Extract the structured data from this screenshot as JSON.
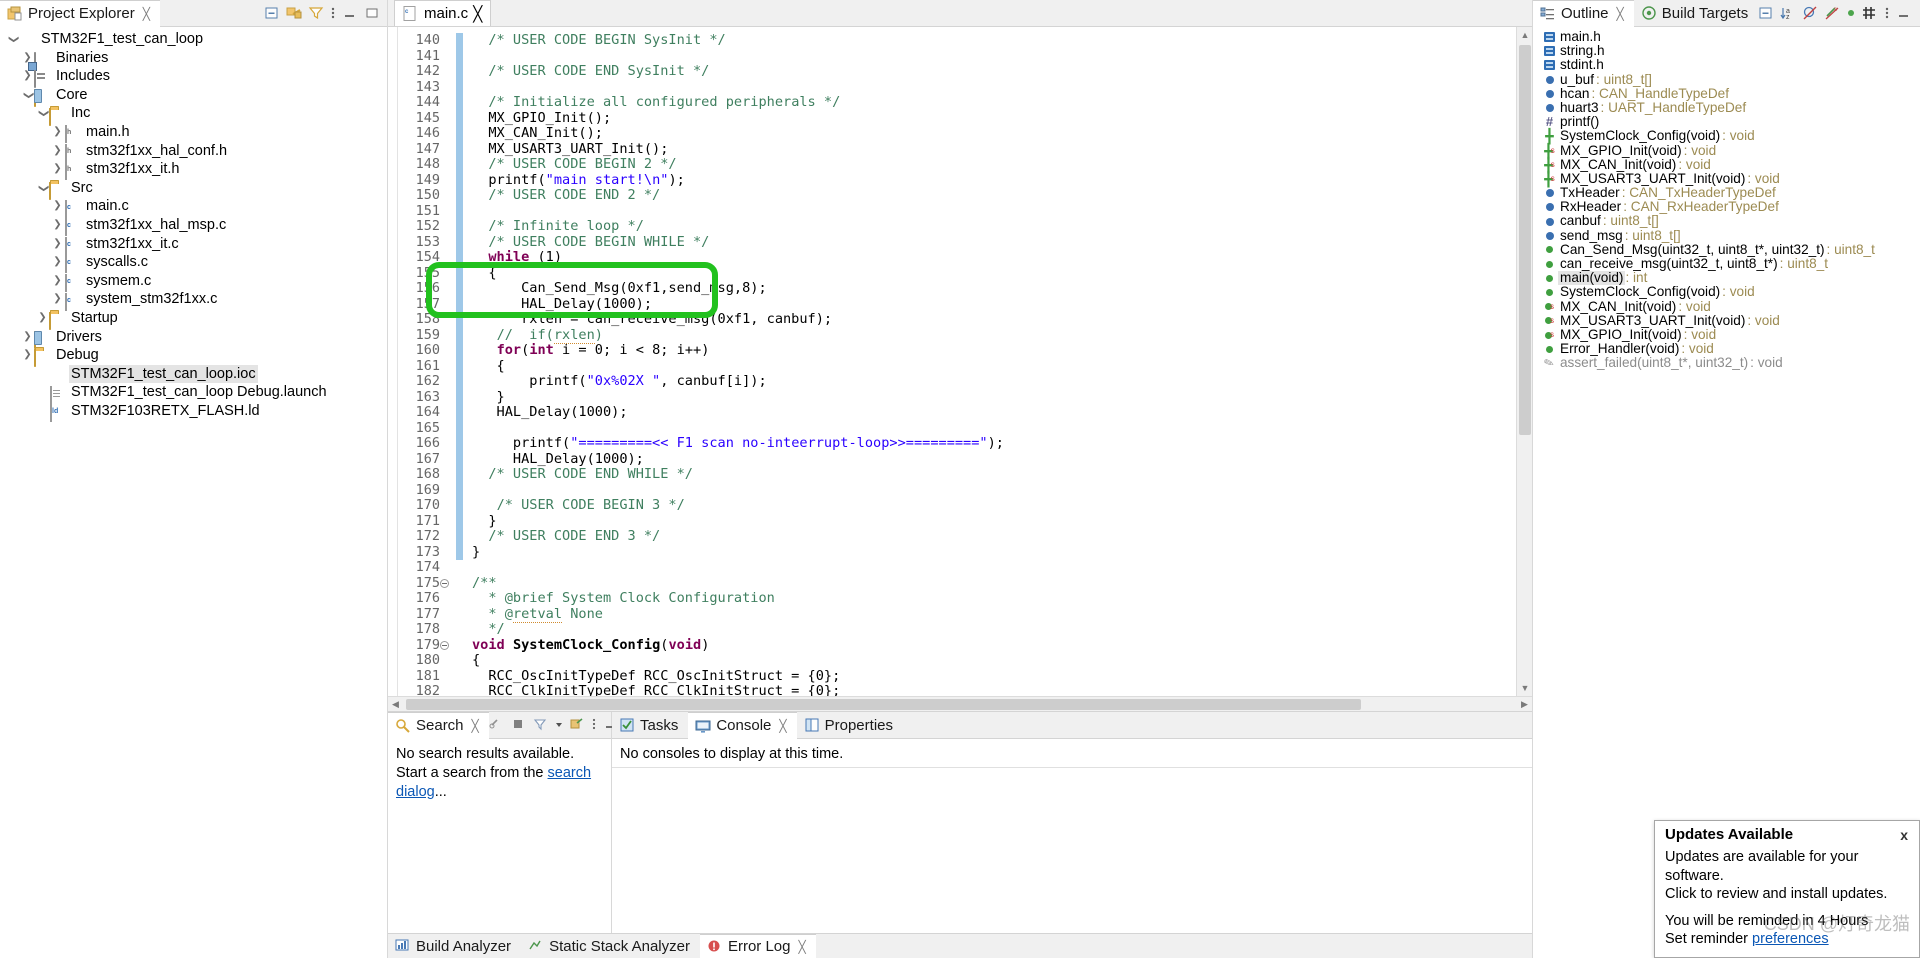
{
  "explorer": {
    "title": "Project Explorer",
    "toolbar_icons": [
      "collapse-all-icon",
      "link-with-editor-icon",
      "view-filter-icon",
      "view-menu-icon",
      "minimize-icon",
      "maximize-icon"
    ],
    "tree": [
      {
        "label": "STM32F1_test_can_loop",
        "indent": 0,
        "twisty": "v",
        "icon": "ide-project-icon",
        "selected": false
      },
      {
        "label": "Binaries",
        "indent": 1,
        "twisty": ">",
        "icon": "binaries-icon",
        "selected": false
      },
      {
        "label": "Includes",
        "indent": 1,
        "twisty": ">",
        "icon": "includes-icon",
        "selected": false
      },
      {
        "label": "Core",
        "indent": 1,
        "twisty": "v",
        "icon": "source-folder-icon",
        "selected": false
      },
      {
        "label": "Inc",
        "indent": 2,
        "twisty": "v",
        "icon": "folder-icon",
        "selected": false
      },
      {
        "label": "main.h",
        "indent": 3,
        "twisty": ">",
        "icon": "h-file-icon",
        "selected": false
      },
      {
        "label": "stm32f1xx_hal_conf.h",
        "indent": 3,
        "twisty": ">",
        "icon": "h-file-icon",
        "selected": false
      },
      {
        "label": "stm32f1xx_it.h",
        "indent": 3,
        "twisty": ">",
        "icon": "h-file-icon",
        "selected": false
      },
      {
        "label": "Src",
        "indent": 2,
        "twisty": "v",
        "icon": "folder-icon",
        "selected": false
      },
      {
        "label": "main.c",
        "indent": 3,
        "twisty": ">",
        "icon": "c-file-icon",
        "selected": false
      },
      {
        "label": "stm32f1xx_hal_msp.c",
        "indent": 3,
        "twisty": ">",
        "icon": "c-file-icon",
        "selected": false
      },
      {
        "label": "stm32f1xx_it.c",
        "indent": 3,
        "twisty": ">",
        "icon": "c-file-icon",
        "selected": false
      },
      {
        "label": "syscalls.c",
        "indent": 3,
        "twisty": ">",
        "icon": "c-file-icon",
        "selected": false
      },
      {
        "label": "sysmem.c",
        "indent": 3,
        "twisty": ">",
        "icon": "c-file-icon",
        "selected": false
      },
      {
        "label": "system_stm32f1xx.c",
        "indent": 3,
        "twisty": ">",
        "icon": "c-file-icon",
        "selected": false
      },
      {
        "label": "Startup",
        "indent": 2,
        "twisty": ">",
        "icon": "folder-icon",
        "selected": false
      },
      {
        "label": "Drivers",
        "indent": 1,
        "twisty": ">",
        "icon": "source-folder-icon",
        "selected": false
      },
      {
        "label": "Debug",
        "indent": 1,
        "twisty": ">",
        "icon": "folder-icon",
        "selected": false
      },
      {
        "label": "STM32F1_test_can_loop.ioc",
        "indent": 2,
        "twisty": "",
        "icon": "cubemx-icon",
        "selected": true
      },
      {
        "label": "STM32F1_test_can_loop Debug.launch",
        "indent": 2,
        "twisty": "",
        "icon": "launch-file-icon",
        "selected": false
      },
      {
        "label": "STM32F103RETX_FLASH.ld",
        "indent": 2,
        "twisty": "",
        "icon": "ld-file-icon",
        "selected": false
      }
    ]
  },
  "editor": {
    "tab_label": "main.c",
    "tab_icon": "c-file-icon",
    "first_line": 140,
    "lines": [
      {
        "n": 140,
        "html": "  <span class=\"cm\">/* USER CODE BEGIN SysInit */</span>"
      },
      {
        "n": 141,
        "html": ""
      },
      {
        "n": 142,
        "html": "  <span class=\"cm\">/* USER CODE END SysInit */</span>"
      },
      {
        "n": 143,
        "html": ""
      },
      {
        "n": 144,
        "html": "  <span class=\"cm\">/* Initialize all configured peripherals */</span>"
      },
      {
        "n": 145,
        "html": "  MX_GPIO_Init();"
      },
      {
        "n": 146,
        "html": "  MX_CAN_Init();"
      },
      {
        "n": 147,
        "html": "  MX_USART3_UART_Init();"
      },
      {
        "n": 148,
        "html": "  <span class=\"cm\">/* USER CODE BEGIN 2 */</span>"
      },
      {
        "n": 149,
        "html": "  printf(<span class=\"str\">\"main start!\\n\"</span>);"
      },
      {
        "n": 150,
        "html": "  <span class=\"cm\">/* USER CODE END 2 */</span>"
      },
      {
        "n": 151,
        "html": ""
      },
      {
        "n": 152,
        "html": "  <span class=\"cm\">/* Infinite loop */</span>"
      },
      {
        "n": 153,
        "html": "  <span class=\"cm\">/* USER CODE BEGIN WHILE */</span>"
      },
      {
        "n": 154,
        "html": "  <span class=\"kw\">while</span> (1)"
      },
      {
        "n": 155,
        "html": "  {"
      },
      {
        "n": 156,
        "html": "      Can_Send_Msg(0xf1,send_msg,8);"
      },
      {
        "n": 157,
        "html": "      HAL_Delay(1000);"
      },
      {
        "n": 158,
        "html": "      rxlen = can_receive_msg(0xf1, canbuf);"
      },
      {
        "n": 159,
        "html": "   <span class=\"cm\">//  if(<span class=\"squiggle\">rxlen</span>)</span>"
      },
      {
        "n": 160,
        "html": "   <span class=\"kw\">for</span>(<span class=\"kw\">int</span> i = 0; i &lt; 8; i++)"
      },
      {
        "n": 161,
        "html": "   {"
      },
      {
        "n": 162,
        "html": "       printf(<span class=\"str\">\"0x%02X \"</span>, canbuf[i]);"
      },
      {
        "n": 163,
        "html": "   }"
      },
      {
        "n": 164,
        "html": "   HAL_Delay(1000);"
      },
      {
        "n": 165,
        "html": ""
      },
      {
        "n": 166,
        "html": "     printf(<span class=\"str\">\"=========&lt;&lt; F1 scan no-inteerrupt-loop&gt;&gt;=========\"</span>);"
      },
      {
        "n": 167,
        "html": "     HAL_Delay(1000);"
      },
      {
        "n": 168,
        "html": "  <span class=\"cm\">/* USER CODE END WHILE */</span>"
      },
      {
        "n": 169,
        "html": ""
      },
      {
        "n": 170,
        "html": "   <span class=\"cm\">/* USER CODE BEGIN 3 */</span>"
      },
      {
        "n": 171,
        "html": "  }"
      },
      {
        "n": 172,
        "html": "  <span class=\"cm\">/* USER CODE END 3 */</span>"
      },
      {
        "n": 173,
        "html": "}"
      },
      {
        "n": 174,
        "html": ""
      },
      {
        "n": 175,
        "html": "<span class=\"cm\">/**</span>",
        "fold": true
      },
      {
        "n": 176,
        "html": "  <span class=\"cm\">* @brief System Clock Configuration</span>"
      },
      {
        "n": 177,
        "html": "  <span class=\"cm\">* @<span class=\"squiggle\">retval</span> None</span>"
      },
      {
        "n": 178,
        "html": "  <span class=\"cm\">*/</span>"
      },
      {
        "n": 179,
        "html": "<span class=\"kw\">void</span> <span class=\"fn\">SystemClock_Config</span>(<span class=\"kw\">void</span>)",
        "fold": true
      },
      {
        "n": 180,
        "html": "{"
      },
      {
        "n": 181,
        "html": "  RCC_OscInitTypeDef RCC_OscInitStruct = {0};"
      },
      {
        "n": 182,
        "html": "  RCC_ClkInitTypeDef RCC_ClkInitStruct = {0};"
      }
    ],
    "annotation": {
      "name": "green-highlight-box",
      "color": "#22c11e",
      "covers_lines": [
        155,
        156,
        157
      ]
    }
  },
  "outline": {
    "tabs": [
      {
        "label": "Outline",
        "icon": "outline-icon",
        "active": true
      },
      {
        "label": "Build Targets",
        "icon": "build-targets-icon",
        "active": false
      }
    ],
    "toolbar_icons": [
      "collapse-all-icon",
      "sort-icon",
      "hide-fields-icon",
      "hide-static-icon",
      "hide-nonpublic-icon",
      "focus-icon",
      "view-menu-icon",
      "minimize-icon",
      "maximize-icon"
    ],
    "items": [
      {
        "name": "main.h",
        "type": "",
        "icon": "include-icon",
        "selected": false,
        "static": false,
        "dim": false
      },
      {
        "name": "string.h",
        "type": "",
        "icon": "include-icon",
        "selected": false,
        "static": false,
        "dim": false
      },
      {
        "name": "stdint.h",
        "type": "",
        "icon": "include-icon",
        "selected": false,
        "static": false,
        "dim": false
      },
      {
        "name": "u_buf",
        "type": " : uint8_t[]",
        "icon": "variable-icon",
        "selected": false,
        "static": false,
        "dim": false
      },
      {
        "name": "hcan",
        "type": " : CAN_HandleTypeDef",
        "icon": "variable-icon",
        "selected": false,
        "static": false,
        "dim": false
      },
      {
        "name": "huart3",
        "type": " : UART_HandleTypeDef",
        "icon": "variable-icon",
        "selected": false,
        "static": false,
        "dim": false
      },
      {
        "name": "printf()",
        "type": "",
        "icon": "macro-icon",
        "selected": false,
        "static": false,
        "dim": false
      },
      {
        "name": "SystemClock_Config(void)",
        "type": " : void",
        "icon": "prototype-icon",
        "selected": false,
        "static": false,
        "dim": false
      },
      {
        "name": "MX_GPIO_Init(void)",
        "type": " : void",
        "icon": "prototype-icon",
        "selected": false,
        "static": true,
        "dim": false
      },
      {
        "name": "MX_CAN_Init(void)",
        "type": " : void",
        "icon": "prototype-icon",
        "selected": false,
        "static": true,
        "dim": false
      },
      {
        "name": "MX_USART3_UART_Init(void)",
        "type": " : void",
        "icon": "prototype-icon",
        "selected": false,
        "static": true,
        "dim": false
      },
      {
        "name": "TxHeader",
        "type": " : CAN_TxHeaderTypeDef",
        "icon": "variable-icon",
        "selected": false,
        "static": false,
        "dim": false
      },
      {
        "name": "RxHeader",
        "type": " : CAN_RxHeaderTypeDef",
        "icon": "variable-icon",
        "selected": false,
        "static": false,
        "dim": false
      },
      {
        "name": "canbuf",
        "type": " : uint8_t[]",
        "icon": "variable-icon",
        "selected": false,
        "static": false,
        "dim": false
      },
      {
        "name": "send_msg",
        "type": " : uint8_t[]",
        "icon": "variable-icon",
        "selected": false,
        "static": false,
        "dim": false
      },
      {
        "name": "Can_Send_Msg(uint32_t, uint8_t*, uint32_t)",
        "type": " : uint8_t",
        "icon": "function-icon",
        "selected": false,
        "static": false,
        "dim": false
      },
      {
        "name": "can_receive_msg(uint32_t, uint8_t*)",
        "type": " : uint8_t",
        "icon": "function-icon",
        "selected": false,
        "static": false,
        "dim": false
      },
      {
        "name": "main(void)",
        "type": " : int",
        "icon": "function-icon",
        "selected": true,
        "static": false,
        "dim": false
      },
      {
        "name": "SystemClock_Config(void)",
        "type": " : void",
        "icon": "function-icon",
        "selected": false,
        "static": false,
        "dim": false
      },
      {
        "name": "MX_CAN_Init(void)",
        "type": " : void",
        "icon": "function-icon",
        "selected": false,
        "static": true,
        "dim": false
      },
      {
        "name": "MX_USART3_UART_Init(void)",
        "type": " : void",
        "icon": "function-icon",
        "selected": false,
        "static": true,
        "dim": false
      },
      {
        "name": "MX_GPIO_Init(void)",
        "type": " : void",
        "icon": "function-icon",
        "selected": false,
        "static": true,
        "dim": false
      },
      {
        "name": "Error_Handler(void)",
        "type": " : void",
        "icon": "function-icon",
        "selected": false,
        "static": false,
        "dim": false
      },
      {
        "name": "assert_failed(uint8_t*, uint32_t)",
        "type": " : void",
        "icon": "assert-icon",
        "selected": false,
        "static": false,
        "dim": true
      }
    ]
  },
  "search_panel": {
    "tab_label": "Search",
    "tab_icon": "search-icon",
    "toolbar_icons": [
      "remove-match-icon",
      "cancel-icon",
      "show-previous-searches-icon",
      "dropdown-arrow-icon",
      "pin-search-icon",
      "view-menu-icon",
      "minimize-icon",
      "maximize-icon"
    ],
    "message_prefix": "No search results available. Start a search from the ",
    "link_text": "search dialog",
    "message_suffix": "..."
  },
  "console_panel": {
    "tabs": [
      {
        "label": "Tasks",
        "icon": "tasks-icon",
        "active": false
      },
      {
        "label": "Console",
        "icon": "console-icon",
        "active": true
      },
      {
        "label": "Properties",
        "icon": "properties-icon",
        "active": false
      }
    ],
    "message": "No consoles to display at this time."
  },
  "bottom_second_tabs": [
    {
      "label": "Build Analyzer",
      "icon": "build-analyzer-icon",
      "active": false
    },
    {
      "label": "Static Stack Analyzer",
      "icon": "static-stack-icon",
      "active": false
    },
    {
      "label": "Error Log",
      "icon": "error-log-icon",
      "active": true
    }
  ],
  "notification": {
    "title": "Updates Available",
    "close_label": "x",
    "line1": "Updates are available for your software.",
    "line2": "Click to review and install updates.",
    "line3": "You will be reminded in 4 Hours",
    "line4_prefix": "Set reminder ",
    "line4_link": "preferences"
  },
  "watermark": "CSDN @灯奇龙猫"
}
